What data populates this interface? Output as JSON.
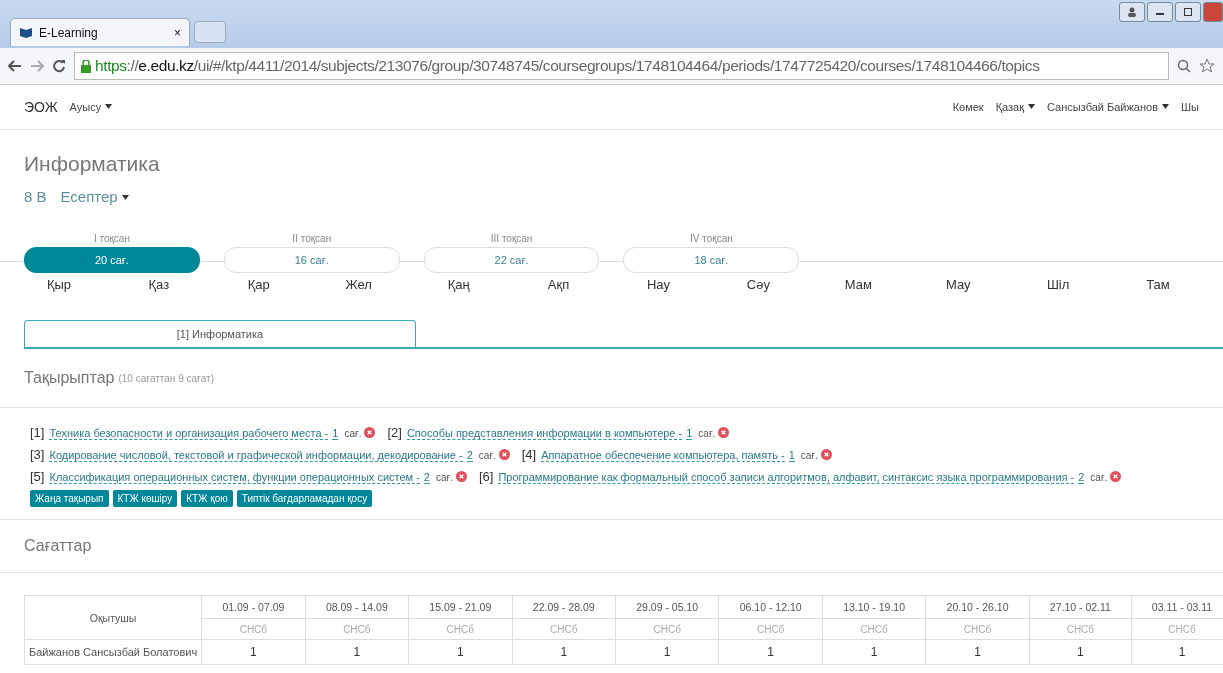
{
  "browser": {
    "tab_title": "E-Learning",
    "tab_close": "×",
    "url": {
      "scheme": "https",
      "sep": "://",
      "host": "e.edu.kz",
      "path": "/ui/#/ktp/4411/2014/subjects/213076/group/30748745/coursegroups/1748104464/periods/1747725420/courses/1748104466/topics"
    }
  },
  "navbar": {
    "brand": "ЭОЖ",
    "switch": "Ауысу",
    "right": [
      {
        "label": "Көмек",
        "dropdown": false
      },
      {
        "label": "Қазақ",
        "dropdown": true
      },
      {
        "label": "Сансызбай Байжанов",
        "dropdown": true
      },
      {
        "label": "Шы",
        "dropdown": false
      }
    ]
  },
  "page": {
    "title": "Информатика",
    "class": "8 В",
    "report": "Есептер"
  },
  "quarters": [
    {
      "label": "I тоқсан",
      "hours": "20 сағ.",
      "selected": true
    },
    {
      "label": "II тоқсан",
      "hours": "16 сағ.",
      "selected": false
    },
    {
      "label": "III тоқсан",
      "hours": "22 сағ.",
      "selected": false
    },
    {
      "label": "IV тоқсан",
      "hours": "18 сағ.",
      "selected": false
    }
  ],
  "months": [
    "Қыр",
    "Қаз",
    "Қар",
    "Жел",
    "Қаң",
    "Ақп",
    "Нау",
    "Сәу",
    "Мам",
    "Мау",
    "Шіл",
    "Там"
  ],
  "course_tabs": [
    {
      "label": "[1] Информатика",
      "selected": true
    }
  ],
  "topics_section": {
    "title": "Тақырыптар",
    "subtitle": "(10 сағаттан 9 сағат)"
  },
  "topics": [
    {
      "number": "[1]",
      "title": "Техника безопасности и организация рабочего места -",
      "hours": "1",
      "unit": "сағ."
    },
    {
      "number": "[2]",
      "title": "Способы представления информации в компьютере -",
      "hours": "1",
      "unit": "сағ."
    },
    {
      "number": "[3]",
      "title": "Кодирование числовой, текстовой и графической информации, декодирование -",
      "hours": "2",
      "unit": "сағ."
    },
    {
      "number": "[4]",
      "title": "Аппаратное обеспечение компьютера, память -",
      "hours": "1",
      "unit": "сағ."
    },
    {
      "number": "[5]",
      "title": "Классификация операционных систем, функции операционных систем -",
      "hours": "2",
      "unit": "сағ."
    },
    {
      "number": "[6]",
      "title": "Программирование как формальный способ записи алгоритмов, алфавит, синтаксис языка программирования -",
      "hours": "2",
      "unit": "сағ."
    }
  ],
  "topic_buttons": [
    "Жаңа тақырып",
    "КТЖ көшіру",
    "КТЖ қою",
    "Типтік бағдарламадан қосу"
  ],
  "hours_section": {
    "title": "Сағаттар"
  },
  "table": {
    "teacher_header": "Оқытушы",
    "weeks": [
      {
        "dates": "01.09 - 07.09",
        "sub": "СНСб"
      },
      {
        "dates": "08.09 - 14.09",
        "sub": "СНСб"
      },
      {
        "dates": "15.09 - 21.09",
        "sub": "СНСб"
      },
      {
        "dates": "22.09 - 28.09",
        "sub": "СНСб"
      },
      {
        "dates": "29.09 - 05.10",
        "sub": "СНСб"
      },
      {
        "dates": "06.10 - 12.10",
        "sub": "СНСб"
      },
      {
        "dates": "13.10 - 19.10",
        "sub": "СНСб"
      },
      {
        "dates": "20.10 - 26.10",
        "sub": "СНСб"
      },
      {
        "dates": "27.10 - 02.11",
        "sub": "СНСб"
      },
      {
        "dates": "03.11 - 03.11",
        "sub": "СНСб"
      }
    ],
    "rows": [
      {
        "teacher": "Байжанов Сансызбай Болатович",
        "values": [
          "1",
          "1",
          "1",
          "1",
          "1",
          "1",
          "1",
          "1",
          "1",
          "1"
        ]
      }
    ]
  }
}
